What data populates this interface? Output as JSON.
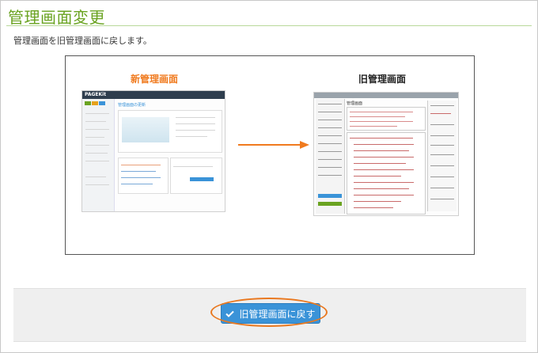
{
  "page": {
    "title": "管理画面変更",
    "description": "管理画面を旧管理画面に戻します。"
  },
  "preview": {
    "new_label": "新管理画面",
    "old_label": "旧管理画面",
    "new_logo": "PAGEKit",
    "new_heading": "管理画面の更新",
    "old_heading": "管理画面",
    "colors": {
      "accent_orange": "#f07a1e",
      "new_nav": "#3c5a7a",
      "old_nav": "#8a8a8a"
    }
  },
  "footer": {
    "back_button_label": "旧管理画面に戻す",
    "back_button_icon": "check-icon",
    "colors": {
      "button": "#3a93d8",
      "highlight": "#e9781f"
    }
  },
  "colors": {
    "title_green": "#6aa321"
  }
}
